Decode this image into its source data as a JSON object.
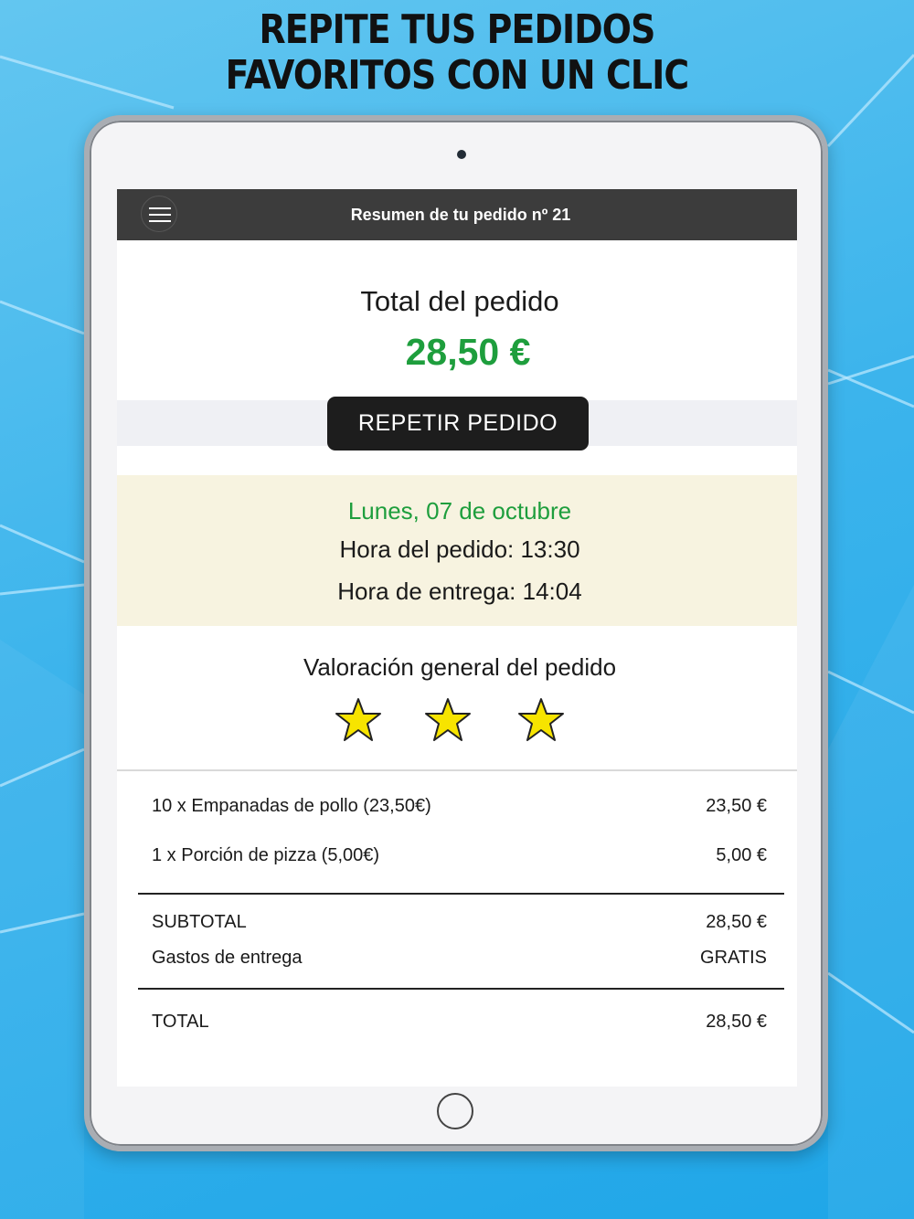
{
  "headline": {
    "line1": "REPITE TUS PEDIDOS",
    "line2": "FAVORITOS CON UN CLIC"
  },
  "appbar": {
    "title": "Resumen de tu pedido nº 21",
    "menu_icon": "hamburger-menu-icon"
  },
  "summary": {
    "total_label": "Total del pedido",
    "total_value": "28,50 €",
    "repeat_button": "REPETIR PEDIDO"
  },
  "dates": {
    "day": "Lunes, 07 de octubre",
    "order_time": "Hora del pedido: 13:30",
    "delivery_time": "Hora de entrega: 14:04"
  },
  "rating": {
    "title": "Valoración general del pedido",
    "stars": 3,
    "star_color": "#f7e400"
  },
  "items": [
    {
      "label": "10 x  Empanadas de pollo (23,50€)",
      "price": "23,50 €"
    },
    {
      "label": "1 x  Porción de pizza (5,00€)",
      "price": "5,00 €"
    }
  ],
  "totals": {
    "subtotal_label": "SUBTOTAL",
    "subtotal_value": "28,50 €",
    "delivery_label": "Gastos de entrega",
    "delivery_value": "GRATIS",
    "total_label": "TOTAL",
    "total_value": "28,50 €"
  },
  "colors": {
    "accent_green": "#1e9e3d",
    "appbar": "#3c3c3c",
    "date_box": "#f7f3e0",
    "background_blue": "#3cb4ec"
  }
}
